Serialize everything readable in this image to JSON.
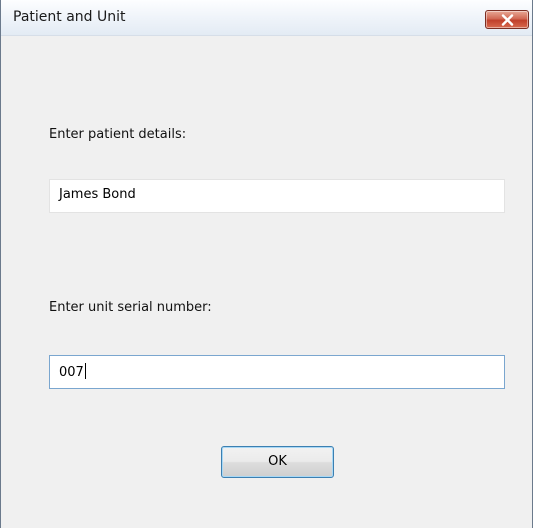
{
  "window": {
    "title": "Patient and Unit"
  },
  "form": {
    "patient_label": "Enter patient details:",
    "patient_value": "James Bond",
    "serial_label": "Enter unit serial number:",
    "serial_value": "007",
    "ok_label": "OK"
  },
  "icons": {
    "close": "close-icon"
  },
  "colors": {
    "close_button": "#c0402b",
    "focus_border": "#7aa6cf",
    "default_button_border": "#3c7fb1"
  }
}
